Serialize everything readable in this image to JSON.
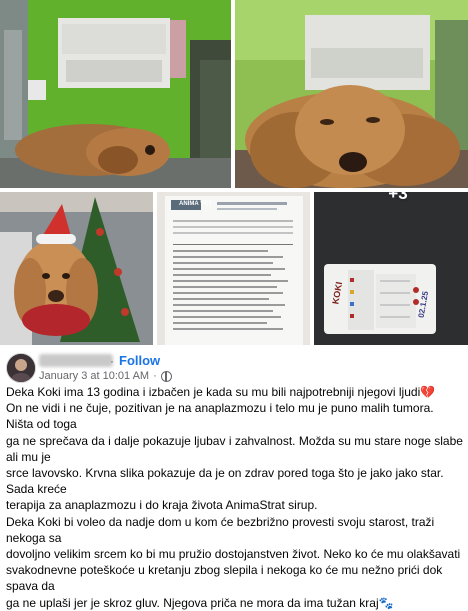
{
  "photos": {
    "more_count": "+3",
    "form_header": "ANIMA VET",
    "test_kit_label": "KOKI",
    "test_kit_date": "02.1.25"
  },
  "post": {
    "author_name": "",
    "follow_label": "Follow",
    "timestamp": "January 3 at 10:01 AM",
    "privacy_icon": "globe-icon",
    "lines": [
      "Deka Koki ima 13 godina i izbačen je kada su mu bili najpotrebniji njegovi ljudi💔",
      "On ne vidi i ne čuje, pozitivan je na anaplazmozu i telo mu je puno malih tumora. Ništa od toga",
      "ga ne sprečava da i dalje pokazuje ljubav i zahvalnost. Možda su mu stare noge slabe ali mu je",
      "srce lavovsko. Krvna slika pokazuje da je on zdrav pored toga što je jako jako star. Sada kreće",
      "terapija za anaplazmozu i do kraja života AnimaStrat sirup.",
      "Deka Koki bi voleo da nadje dom u kom će bezbrižno provesti svoju starost, traži nekoga sa",
      "dovoljno velikim srcem ko bi mu pružio dostojanstven život. Neko ko će mu olakšavati",
      "svakodnevne poteškoće u kretanju zbog slepila  i nekoga ko će mu nežno prići dok spava da",
      "ga ne uplaši jer je skroz gluv. Njegova priča ne mora da ima tužan kraj🐾"
    ]
  }
}
